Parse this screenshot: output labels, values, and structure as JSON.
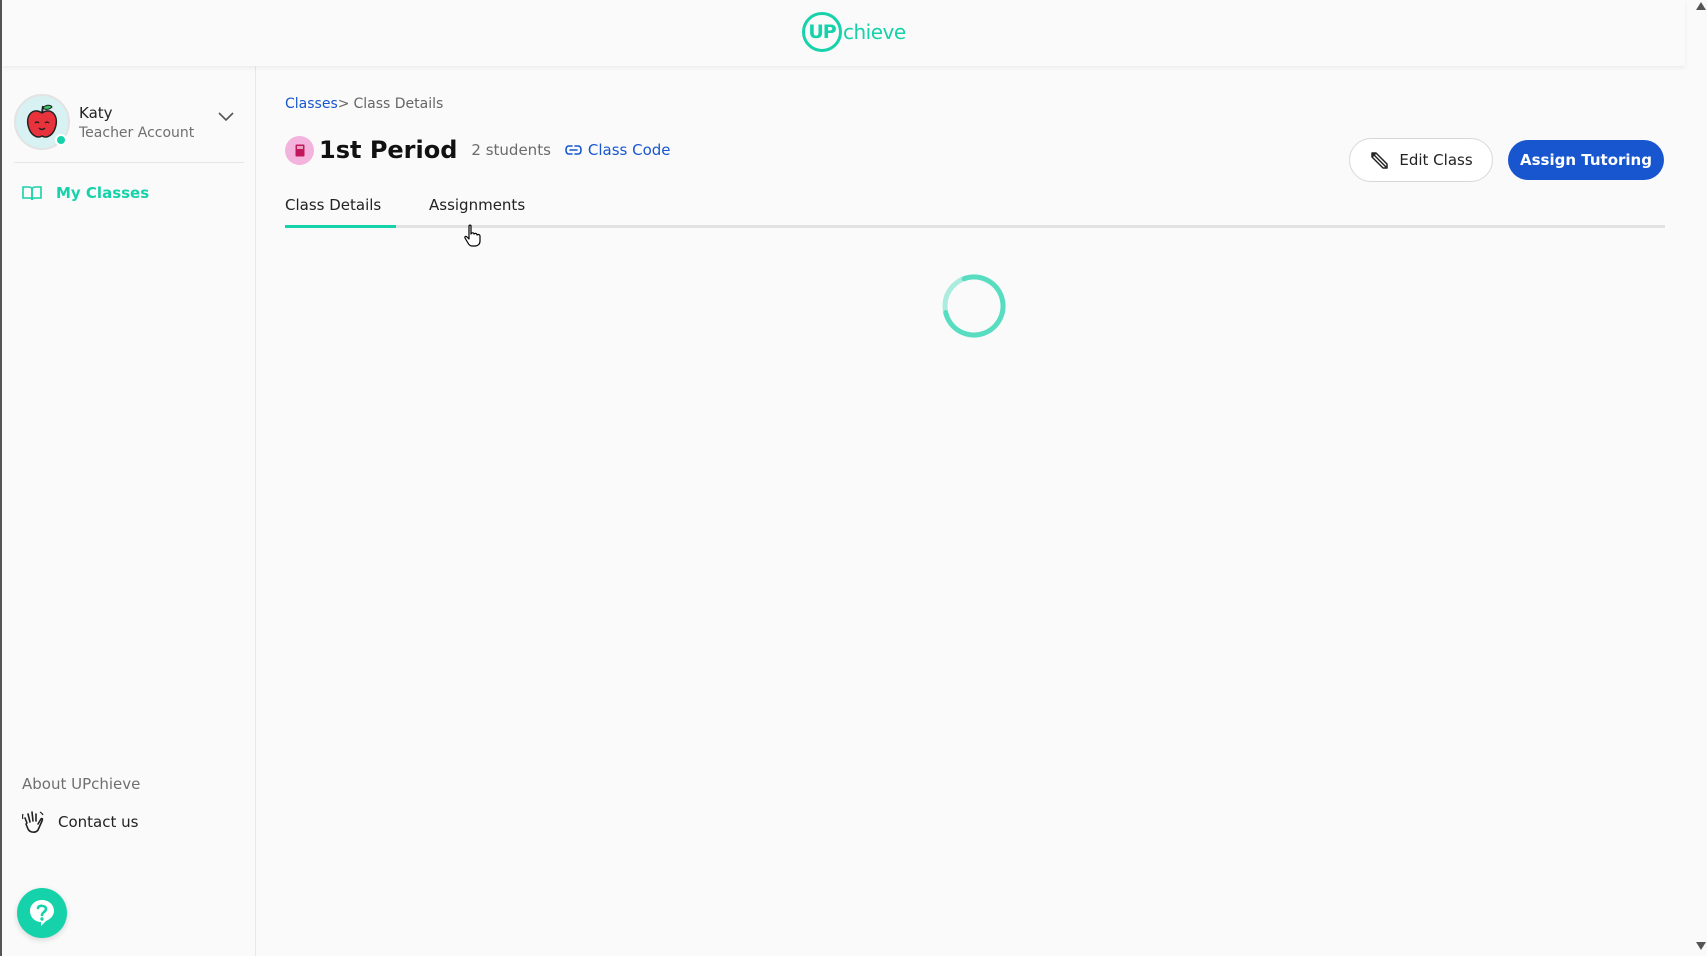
{
  "header": {
    "logo_up": "UP",
    "logo_rest": "chieve"
  },
  "sidebar": {
    "user_name": "Katy",
    "user_role": "Teacher Account",
    "nav_items": [
      {
        "label": "My Classes",
        "icon": "book-open-icon"
      }
    ],
    "about_label": "About UPchieve",
    "contact_label": "Contact us"
  },
  "breadcrumb": {
    "parent": "Classes",
    "separator": ">",
    "current": "Class Details"
  },
  "class": {
    "title": "1st Period",
    "student_count": "2 students",
    "class_code_label": "Class Code"
  },
  "actions": {
    "edit_label": "Edit Class",
    "assign_label": "Assign Tutoring"
  },
  "tabs": [
    {
      "label": "Class Details",
      "active": true
    },
    {
      "label": "Assignments",
      "active": false
    }
  ],
  "colors": {
    "accent": "#16d2aa",
    "primary": "#1856cf",
    "class_badge": "#f3b3dd"
  }
}
